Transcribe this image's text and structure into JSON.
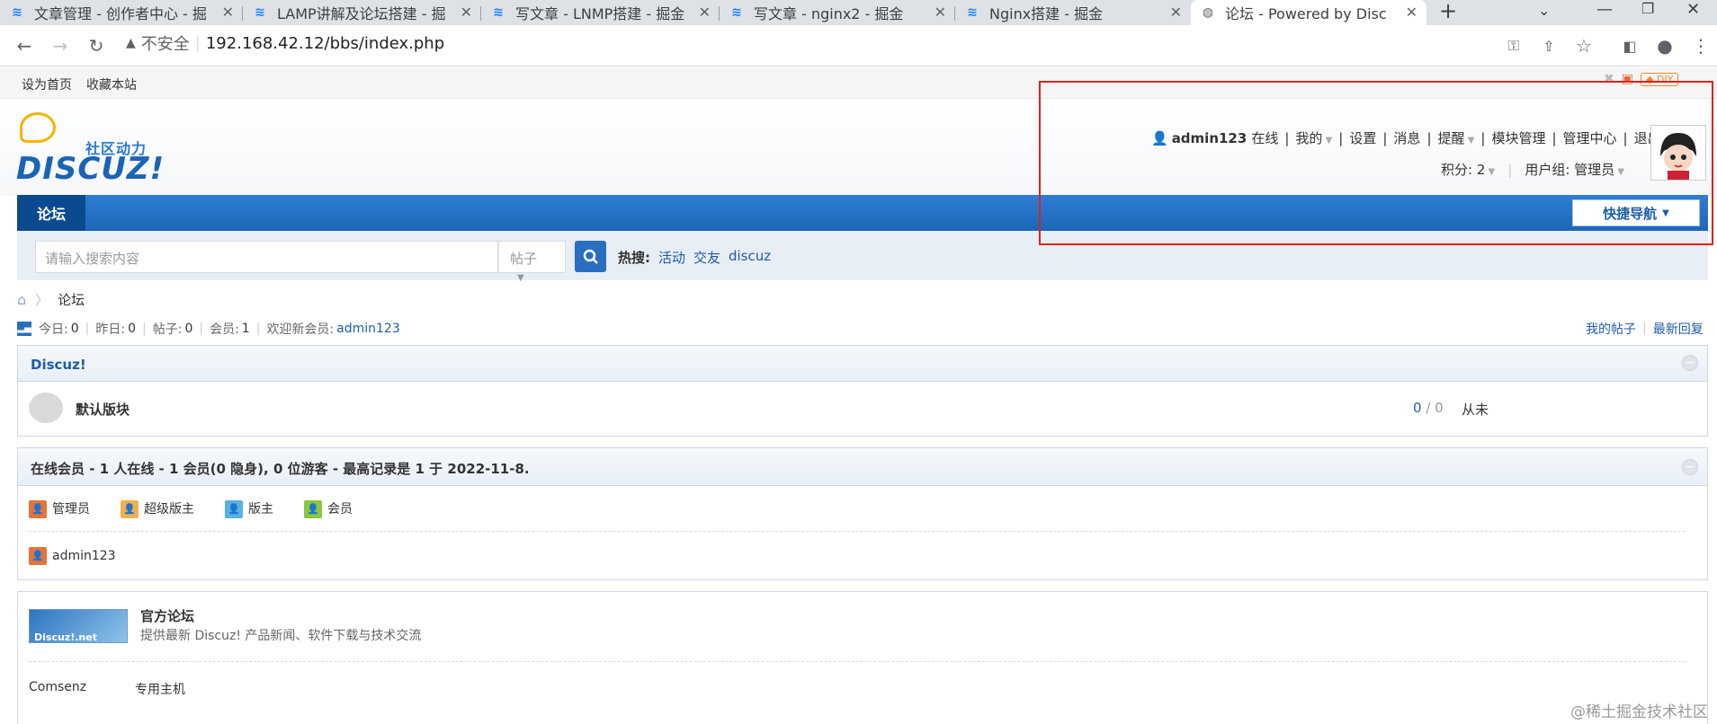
{
  "browser": {
    "tabs": [
      {
        "title": "文章管理 - 创作者中心 - 掘"
      },
      {
        "title": "LAMP讲解及论坛搭建 - 掘"
      },
      {
        "title": "写文章 - LNMP搭建 - 掘金"
      },
      {
        "title": "写文章 - nginx2 - 掘金"
      },
      {
        "title": "Nginx搭建 - 掘金"
      },
      {
        "title": "论坛 - Powered by Discuz"
      }
    ],
    "insecure_label": "不安全",
    "url": "192.168.42.12/bbs/index.php"
  },
  "sitetop": {
    "set_home": "设为首页",
    "bookmark": "收藏本站"
  },
  "logo": {
    "cn": "社区动力",
    "en": "DISCUZ!"
  },
  "user": {
    "name": "admin123",
    "online": "在线",
    "menu": [
      "我的",
      "设置",
      "消息",
      "提醒",
      "模块管理",
      "管理中心",
      "退出"
    ],
    "credits_label": "积分: 2",
    "group_label": "用户组: 管理员"
  },
  "nav": {
    "forum": "论坛",
    "quick_nav": "快捷导航"
  },
  "search": {
    "placeholder": "请输入搜索内容",
    "type": "帖子",
    "hot_label": "热搜:",
    "hot_links": [
      "活动",
      "交友",
      "discuz"
    ]
  },
  "breadcrumb": {
    "current": "论坛"
  },
  "stats": {
    "today_label": "今日:",
    "today": "0",
    "yesterday_label": "昨日:",
    "yesterday": "0",
    "posts_label": "帖子:",
    "posts": "0",
    "members_label": "会员:",
    "members": "1",
    "welcome_label": "欢迎新会员:",
    "welcome_user": "admin123"
  },
  "right_links": {
    "my_posts": "我的帖子",
    "latest": "最新回复"
  },
  "forum_panel": {
    "title": "Discuz!",
    "board_name": "默认版块",
    "counts_a": "0",
    "counts_b": "0",
    "last": "从未"
  },
  "online_panel": {
    "title": "在线会员 - 1 人在线 - 1 会员(0 隐身), 0 位游客 - 最高记录是 1 于 2022-11-8.",
    "legend": [
      "管理员",
      "超级版主",
      "版主",
      "会员"
    ],
    "members": [
      "admin123"
    ]
  },
  "links_panel": {
    "logo_text": "Discuz!.net",
    "title": "官方论坛",
    "desc": "提供最新 Discuz! 产品新闻、软件下载与技术交流",
    "footer": [
      "Comsenz",
      "专用主机"
    ]
  },
  "watermark": "@稀土掘金技术社区",
  "colors": {
    "accent": "#1f5ca8",
    "nav": "#2f7ed4",
    "highlight": "#e02020"
  }
}
